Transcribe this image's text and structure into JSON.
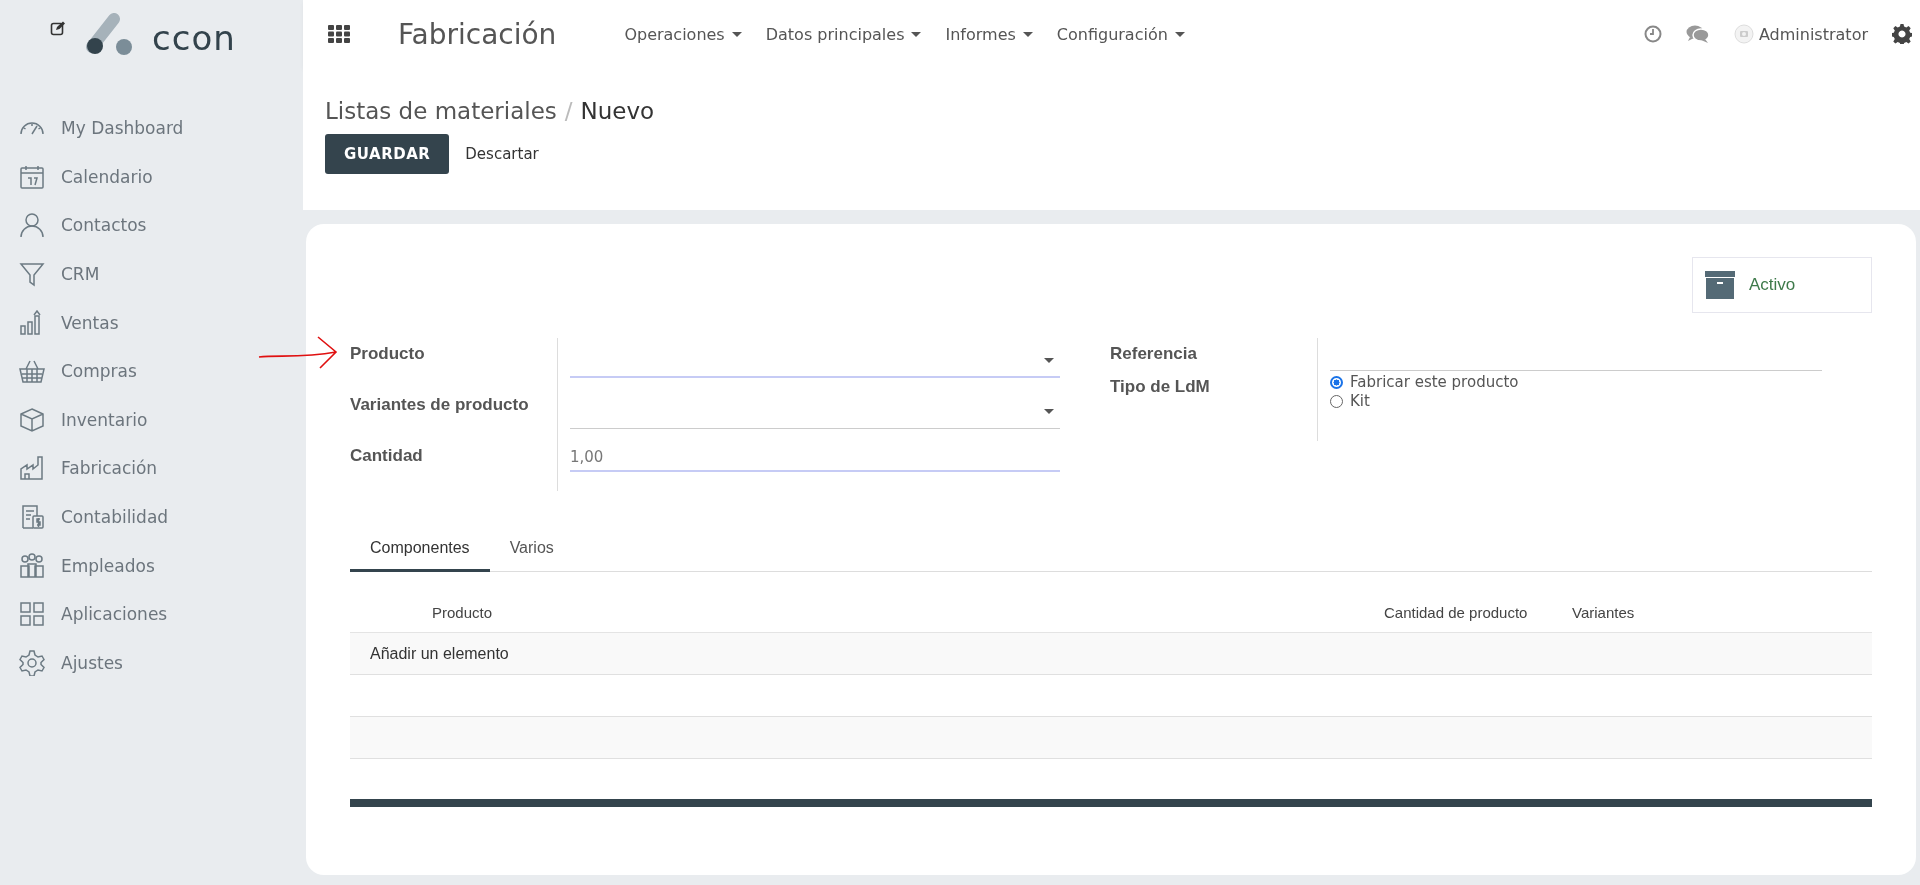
{
  "sidebar": {
    "logo_text": "ccon",
    "items": [
      {
        "label": "My Dashboard"
      },
      {
        "label": "Calendario"
      },
      {
        "label": "Contactos"
      },
      {
        "label": "CRM"
      },
      {
        "label": "Ventas"
      },
      {
        "label": "Compras"
      },
      {
        "label": "Inventario"
      },
      {
        "label": "Fabricación"
      },
      {
        "label": "Contabilidad"
      },
      {
        "label": "Empleados"
      },
      {
        "label": "Aplicaciones"
      },
      {
        "label": "Ajustes"
      }
    ]
  },
  "topbar": {
    "app_title": "Fabricación",
    "menus": [
      {
        "label": "Operaciones"
      },
      {
        "label": "Datos principales"
      },
      {
        "label": "Informes"
      },
      {
        "label": "Configuración"
      }
    ],
    "user": "Administrator"
  },
  "breadcrumb": {
    "parent": "Listas de materiales",
    "separator": "/",
    "current": "Nuevo"
  },
  "buttons": {
    "save": "GUARDAR",
    "discard": "Descartar"
  },
  "stat_button": {
    "label": "Activo"
  },
  "left_fields": [
    {
      "label": "Producto",
      "kind": "dropdown",
      "required": true
    },
    {
      "label": "Variantes de producto",
      "kind": "dropdown",
      "required": false
    },
    {
      "label": "Cantidad",
      "kind": "number",
      "required": true,
      "value": "1,00"
    }
  ],
  "right_fields": [
    {
      "label": "Referencia",
      "kind": "text"
    },
    {
      "label": "Tipo de LdM",
      "kind": "radio",
      "options": [
        {
          "label": "Fabricar este producto",
          "selected": true
        },
        {
          "label": "Kit",
          "selected": false
        }
      ]
    }
  ],
  "tabs": [
    {
      "label": "Componentes",
      "selected": true
    },
    {
      "label": "Varios",
      "selected": false
    }
  ],
  "table": {
    "columns": [
      "Producto",
      "Cantidad de producto",
      "Variantes"
    ],
    "add_line": "Añadir un elemento"
  }
}
